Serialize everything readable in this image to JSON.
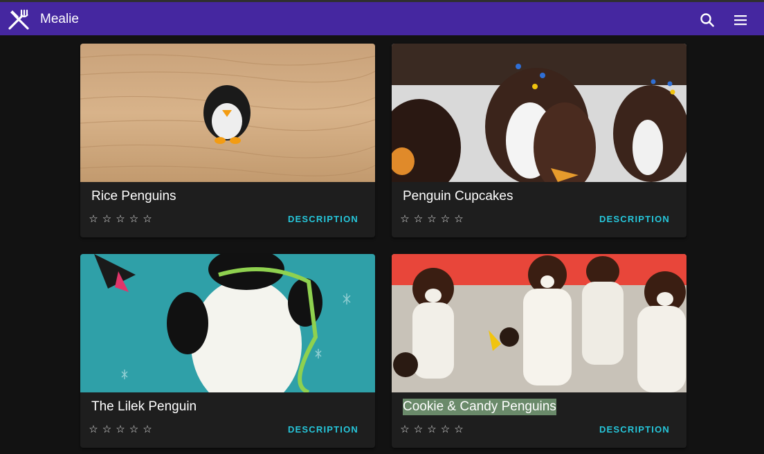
{
  "app": {
    "title": "Mealie"
  },
  "header": {
    "logo_icon": "fork-knife-icon",
    "search_icon": "search-icon",
    "menu_icon": "hamburger-menu-icon"
  },
  "cards": [
    {
      "title": "Rice Penguins",
      "rating": 0,
      "max_rating": 5,
      "action_label": "DESCRIPTION"
    },
    {
      "title": "Penguin Cupcakes",
      "rating": 0,
      "max_rating": 5,
      "action_label": "DESCRIPTION"
    },
    {
      "title": "The Lilek Penguin",
      "rating": 0,
      "max_rating": 5,
      "action_label": "DESCRIPTION"
    },
    {
      "title": "Cookie & Candy Penguins",
      "rating": 0,
      "max_rating": 5,
      "action_label": "DESCRIPTION",
      "selected": true
    }
  ],
  "colors": {
    "appbar": "#4527a0",
    "background": "#121212",
    "card": "#1e1e1e",
    "accent": "#26c6da"
  }
}
